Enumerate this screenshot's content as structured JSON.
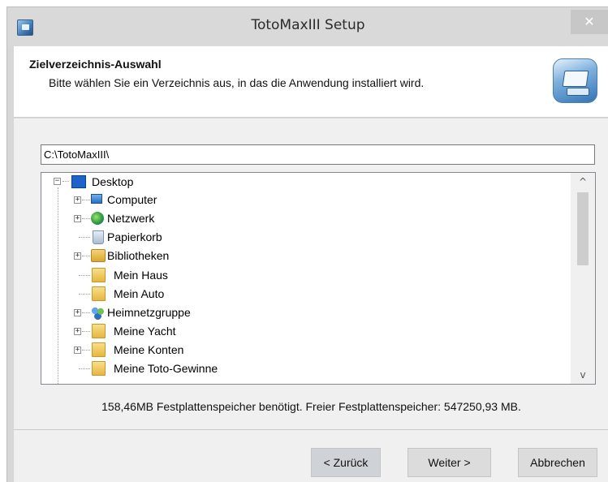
{
  "window": {
    "title": "TotoMaxIII Setup",
    "close_glyph": "✕",
    "app_icon": "setup-app-icon"
  },
  "header": {
    "title": "Zielverzeichnis-Auswahl",
    "subtitle": "Bitte wählen Sie ein Verzeichnis aus, in das die Anwendung installiert wird.",
    "icon": "installer-computer-icon"
  },
  "path": {
    "value": "C:\\TotoMaxIII\\"
  },
  "tree": {
    "items": [
      {
        "label": "Desktop",
        "icon": "desktop-icon",
        "expander": "−"
      },
      {
        "label": "Computer",
        "icon": "computer-icon",
        "expander": "+"
      },
      {
        "label": "Netzwerk",
        "icon": "network-icon",
        "expander": "+"
      },
      {
        "label": "Papierkorb",
        "icon": "recycle-bin-icon",
        "expander": ""
      },
      {
        "label": "Bibliotheken",
        "icon": "libraries-icon",
        "expander": "+"
      },
      {
        "label": "Mein Haus",
        "icon": "folder-icon",
        "expander": ""
      },
      {
        "label": "Mein Auto",
        "icon": "folder-icon",
        "expander": ""
      },
      {
        "label": "Heimnetzgruppe",
        "icon": "homegroup-icon",
        "expander": "+"
      },
      {
        "label": "Meine Yacht",
        "icon": "folder-icon",
        "expander": "+"
      },
      {
        "label": "Meine Konten",
        "icon": "folder-icon",
        "expander": "+"
      },
      {
        "label": "Meine Toto-Gewinne",
        "icon": "folder-icon",
        "expander": ""
      }
    ],
    "scroll_up": "^",
    "scroll_down": "v"
  },
  "status": {
    "text": "158,46MB Festplattenspeicher benötigt. Freier Festplattenspeicher: 547250,93 MB."
  },
  "buttons": {
    "back": "< Zurück",
    "next": "Weiter >",
    "cancel": "Abbrechen"
  }
}
